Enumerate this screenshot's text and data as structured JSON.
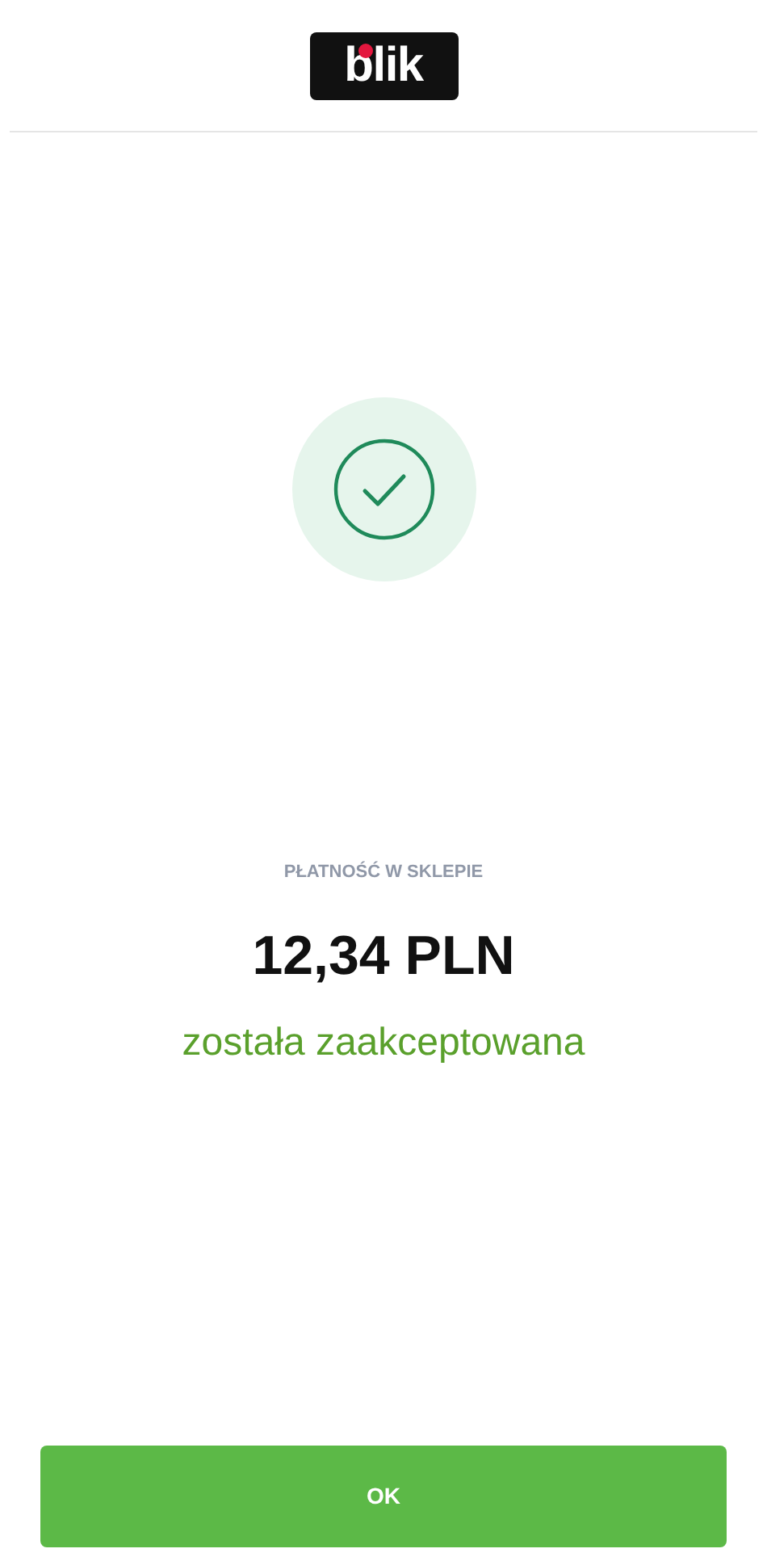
{
  "header": {
    "logo": "blik"
  },
  "status": {
    "kind": "success",
    "label": "PŁATNOŚĆ W SKLEPIE",
    "amount": "12,34 PLN",
    "message": "została zaakceptowana"
  },
  "buttons": [
    "OK"
  ]
}
